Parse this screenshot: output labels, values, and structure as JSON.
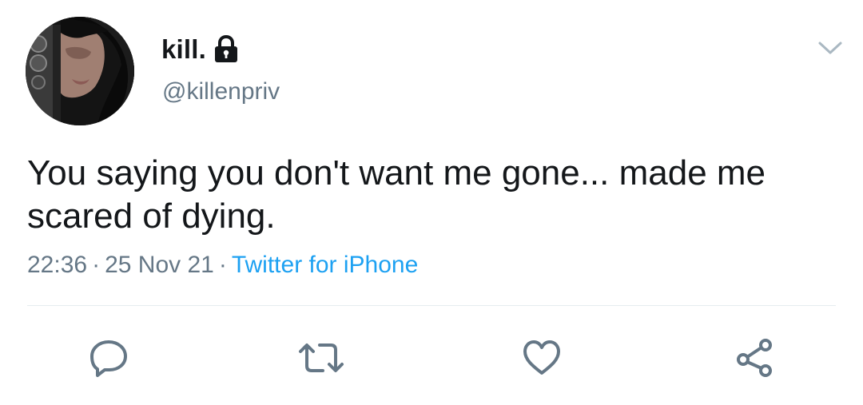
{
  "tweet": {
    "author": {
      "display_name": "kill.",
      "handle": "@killenpriv",
      "protected_icon": "lock-icon"
    },
    "menu_icon": "chevron-down-icon",
    "text": "You saying you don't want me gone... made me scared of dying.",
    "time": "22:36",
    "date": "25 Nov 21",
    "source": "Twitter for iPhone",
    "actions": [
      {
        "name": "reply",
        "icon": "reply-icon"
      },
      {
        "name": "retweet",
        "icon": "retweet-icon"
      },
      {
        "name": "like",
        "icon": "heart-icon"
      },
      {
        "name": "share",
        "icon": "share-icon"
      }
    ]
  },
  "colors": {
    "text_primary": "#14171a",
    "text_secondary": "#657786",
    "link": "#1da1f2",
    "divider": "#e6ecf0"
  }
}
